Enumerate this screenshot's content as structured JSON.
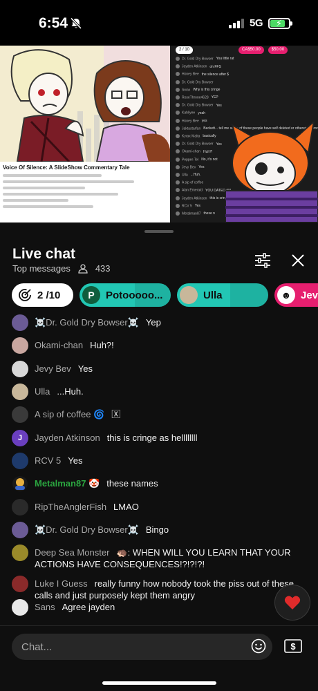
{
  "status_bar": {
    "time": "6:54",
    "network": "5G",
    "battery_percent": 80
  },
  "video": {
    "left_title": "Voice Of Silence: A SlideShow Commentary Tale",
    "mini_chat": {
      "goal": "2 / 10",
      "pill_1": "CA$50.00",
      "pill_2": "$50.00",
      "rows": [
        {
          "author": "Dr. Gold Dry Bowser",
          "text": "You little rat"
        },
        {
          "author": "Jayden Atkinson",
          "text": "oh FFS"
        },
        {
          "author": "Honey Bee",
          "text": "the silence after $"
        },
        {
          "author": "Dr. Gold Dry Bowser",
          "text": ""
        },
        {
          "author": "Swax",
          "text": "Why is this cringe"
        },
        {
          "author": "RoseThrone4628",
          "text": "YEP"
        },
        {
          "author": "Dr. Gold Dry Bowser",
          "text": "Yes"
        },
        {
          "author": "Kahliyee",
          "text": "yeah"
        },
        {
          "author": "Honey Bee",
          "text": "yes"
        },
        {
          "author": "Jaktastarfan",
          "text": "Beckett... tell me some of these people have self deleted or otherwise removed from the gene pool"
        },
        {
          "author": "Kyrax Malta",
          "text": "basically"
        },
        {
          "author": "Dr. Gold Dry Bowser",
          "text": "Yes"
        },
        {
          "author": "Okami-chan",
          "text": "Huh?!"
        },
        {
          "author": "Pepper-Tel",
          "text": "No, it's not"
        },
        {
          "author": "Jevy Bev",
          "text": "Yes"
        },
        {
          "author": "Ulla",
          "text": "...Huh."
        },
        {
          "author": "A sip of coffee",
          "text": ""
        },
        {
          "author": "Alan Emerald",
          "text": "YOU DATED AN"
        },
        {
          "author": "Jayden Atkinson",
          "text": "this is crin"
        },
        {
          "author": "RCV 5",
          "text": "Yes"
        },
        {
          "author": "Metalman87",
          "text": "these n"
        }
      ]
    }
  },
  "header": {
    "title": "Live chat",
    "subtitle": "Top messages",
    "viewer_count": "433"
  },
  "pills": {
    "goal": "2 /10",
    "p_name": "Potooooo...",
    "p_initial": "P",
    "ulla_name": "Ulla",
    "jev_name": "Jev"
  },
  "messages": [
    {
      "author": "☠️Dr. Gold Dry Bowser☠️",
      "text": "Yep",
      "avatar_color": "#6b5b95",
      "initial": ""
    },
    {
      "author": "Okami-chan",
      "text": "Huh?!",
      "avatar_color": "#c9a7a0",
      "initial": ""
    },
    {
      "author": "Jevy Bev",
      "text": "Yes",
      "avatar_color": "#d8d8d8",
      "initial": ""
    },
    {
      "author": "Ulla",
      "text": "...Huh.",
      "avatar_color": "#c8b79a",
      "initial": ""
    },
    {
      "author": "A sip of coffee 🌀",
      "text": "🅇",
      "avatar_color": "#3a3a3a",
      "initial": ""
    },
    {
      "author": "Jayden Atkinson",
      "text": "this is cringe as hellllllll",
      "avatar_color": "#6a3fbf",
      "initial": "J"
    },
    {
      "author": "RCV 5",
      "text": "Yes",
      "avatar_color": "#1e3a6b",
      "initial": ""
    },
    {
      "author": "Metalman87 🤡",
      "text": "these names",
      "avatar_color": "",
      "initial": "",
      "member": true
    },
    {
      "author": "RipTheAnglerFish",
      "text": "LMAO",
      "avatar_color": "#2a2a2a",
      "initial": ""
    },
    {
      "author": "☠️Dr. Gold Dry Bowser☠️",
      "text": "Bingo",
      "avatar_color": "#6b5b95",
      "initial": ""
    },
    {
      "author": "Deep Sea Monster",
      "text": "🦔: WHEN WILL YOU LEARN THAT YOUR ACTIONS HAVE CONSEQUENCES!?!?!?!",
      "avatar_color": "#9a8a2a",
      "initial": ""
    },
    {
      "author": "Luke I Guess",
      "text": "really funny how nobody took the piss out of these calls and just purposely kept them angry",
      "avatar_color": "#8a2a2a",
      "initial": ""
    },
    {
      "author": "Sans",
      "text": "Agree jayden",
      "avatar_color": "#e8e8e8",
      "initial": ""
    }
  ],
  "input": {
    "placeholder": "Chat..."
  },
  "colors": {
    "accent_teal": "#22c7b4",
    "accent_pink": "#e61f6f",
    "member_green": "#2ba640",
    "heart_red": "#e02b2b"
  }
}
